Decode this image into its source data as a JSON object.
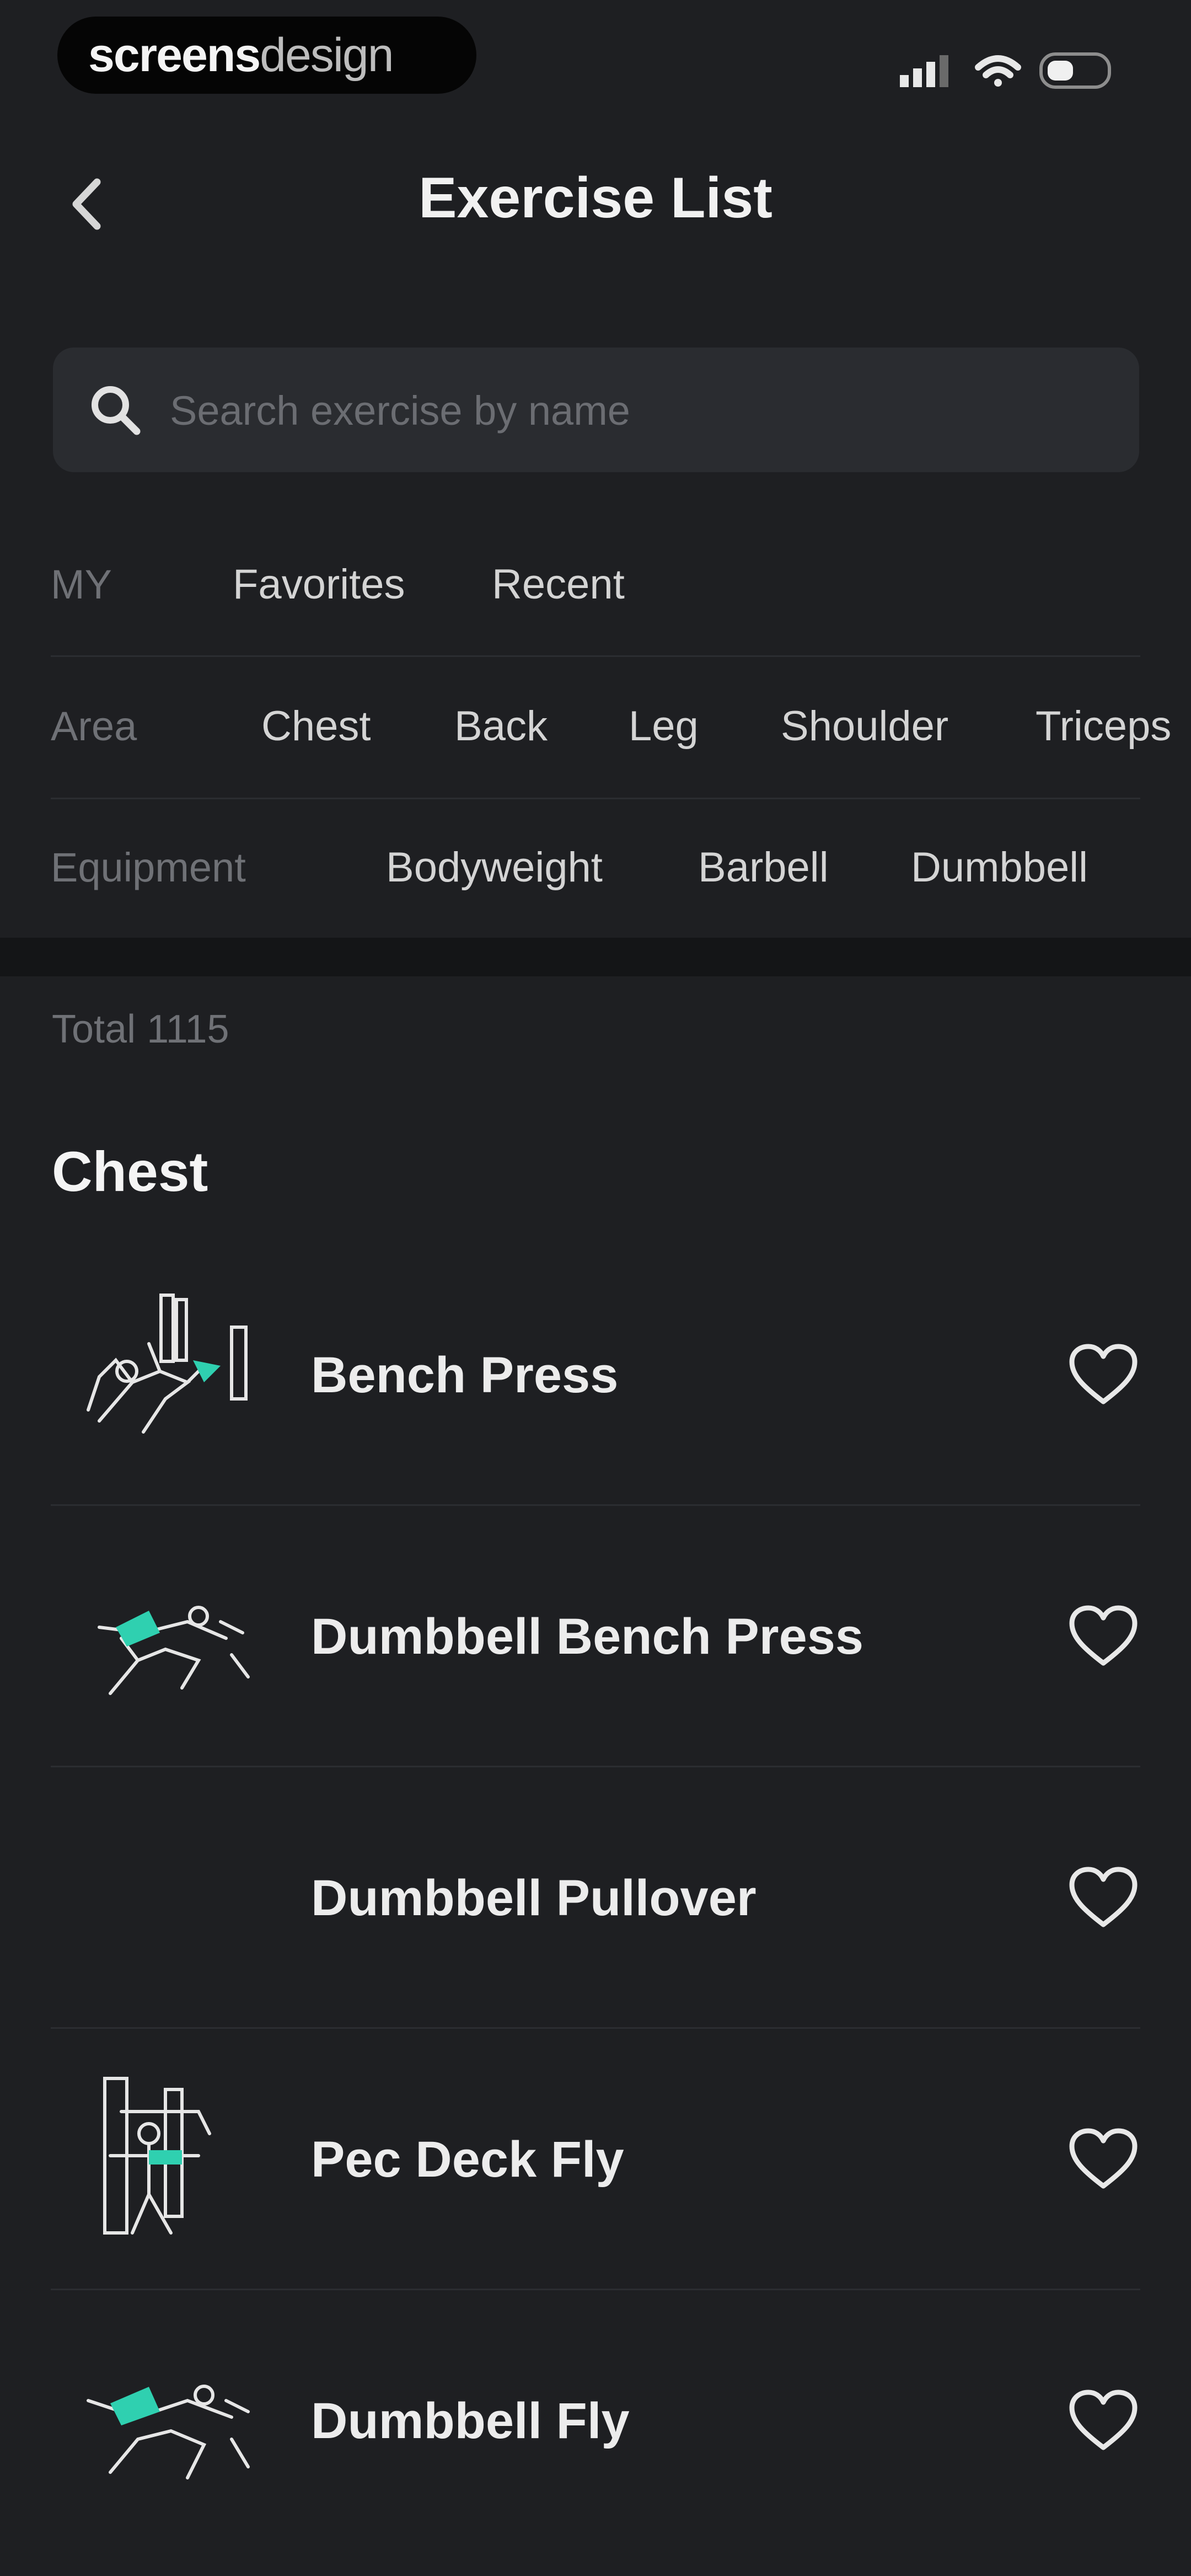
{
  "status_bar": {
    "brand_part1": "screens",
    "brand_part2": "design"
  },
  "header": {
    "title": "Exercise List"
  },
  "search": {
    "placeholder": "Search exercise by name"
  },
  "filters": {
    "my": {
      "label": "MY",
      "options": [
        "Favorites",
        "Recent"
      ]
    },
    "area": {
      "label": "Area",
      "options": [
        "Chest",
        "Back",
        "Leg",
        "Shoulder",
        "Triceps"
      ]
    },
    "equipment": {
      "label": "Equipment",
      "options": [
        "Bodyweight",
        "Barbell",
        "Dumbbell"
      ]
    }
  },
  "total": "Total 1115",
  "section": {
    "title": "Chest"
  },
  "exercises": [
    {
      "name": "Bench Press",
      "icon": "heart-outline-icon"
    },
    {
      "name": "Dumbbell Bench Press",
      "icon": "heart-outline-icon"
    },
    {
      "name": "Dumbbell Pullover",
      "icon": "heart-outline-icon"
    },
    {
      "name": "Pec Deck Fly",
      "icon": "heart-outline-icon"
    },
    {
      "name": "Dumbbell Fly",
      "icon": "heart-outline-icon"
    }
  ],
  "colors": {
    "background": "#1e1f22",
    "search_background": "#2a2c30",
    "accent": "#2fd0b0",
    "muted_text": "#6f7176"
  }
}
